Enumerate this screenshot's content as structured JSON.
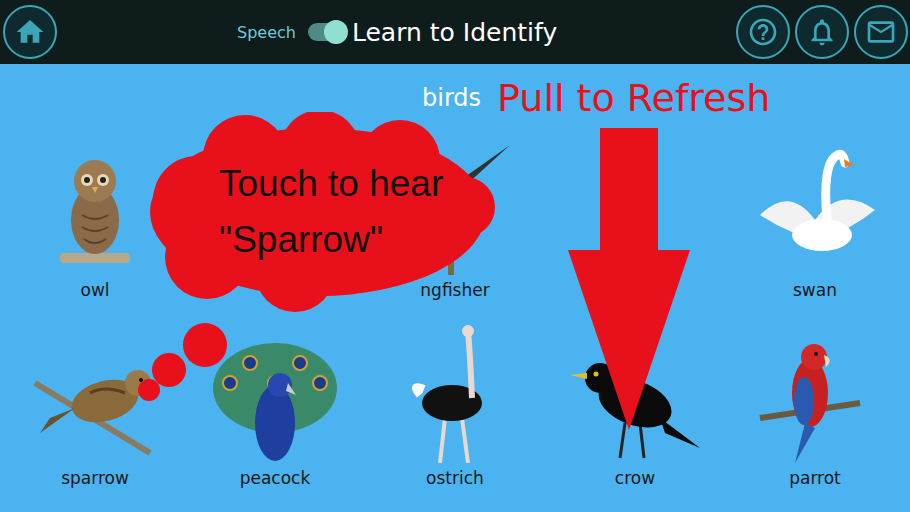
{
  "topbar": {
    "speech": {
      "label": "Speech",
      "on": true
    },
    "title": "Learn to Identify"
  },
  "category": "birds",
  "hint": "Pull to Refresh",
  "tooltip": {
    "lines": [
      "Touch to hear",
      "\"Sparrow\""
    ]
  },
  "rows": [
    [
      {
        "name": "owl"
      },
      {
        "name": "ngfisher"
      },
      {
        "name": "swan"
      }
    ],
    [
      {
        "name": "sparrow"
      },
      {
        "name": "peacock"
      },
      {
        "name": "ostrich"
      },
      {
        "name": "crow"
      },
      {
        "name": "parrot"
      }
    ]
  ]
}
